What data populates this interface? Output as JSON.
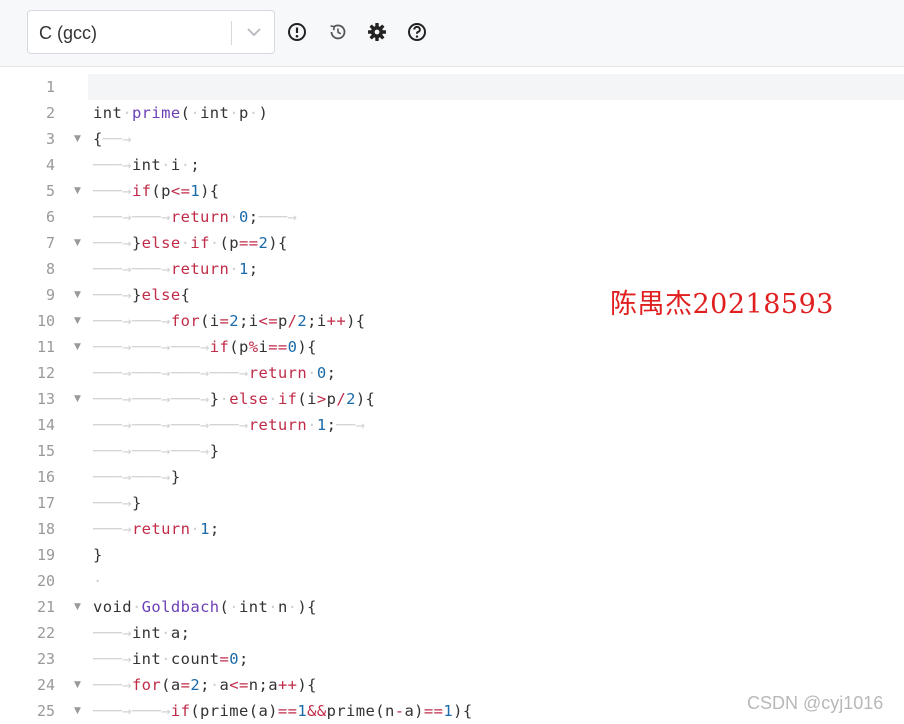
{
  "toolbar": {
    "language": "C (gcc)",
    "icons": [
      "alert-circle-icon",
      "history-icon",
      "gear-icon",
      "help-circle-icon"
    ]
  },
  "editor": {
    "lines": [
      {
        "n": "1"
      },
      {
        "n": "2"
      },
      {
        "n": "3"
      },
      {
        "n": "4"
      },
      {
        "n": "5"
      },
      {
        "n": "6"
      },
      {
        "n": "7"
      },
      {
        "n": "8"
      },
      {
        "n": "9"
      },
      {
        "n": "10"
      },
      {
        "n": "11"
      },
      {
        "n": "12"
      },
      {
        "n": "13"
      },
      {
        "n": "14"
      },
      {
        "n": "15"
      },
      {
        "n": "16"
      },
      {
        "n": "17"
      },
      {
        "n": "18"
      },
      {
        "n": "19"
      },
      {
        "n": "20"
      },
      {
        "n": "21"
      },
      {
        "n": "22"
      },
      {
        "n": "23"
      },
      {
        "n": "24"
      },
      {
        "n": "25"
      }
    ],
    "code": [
      "",
      "int prime( int p )",
      "{",
      "int i ;",
      "if(p<=1){",
      "return 0;",
      "}else if (p==2){",
      "return 1;",
      "}else{",
      "for(i=2;i<=p/2;i++){",
      "if(p%i==0){",
      "return 0;",
      "} else if(i>p/2){",
      "return 1;",
      "}",
      "}",
      "}",
      "return 1;",
      "}",
      "",
      "void Goldbach( int n ){",
      "int a;",
      "int count=0;",
      "for(a=2; a<=n;a++){",
      "if(prime(a)==1&&prime(n-a)==1){"
    ]
  },
  "overlay": {
    "watermark": "陈禺杰20218593",
    "csdn_credit": "CSDN @cyj1016"
  }
}
